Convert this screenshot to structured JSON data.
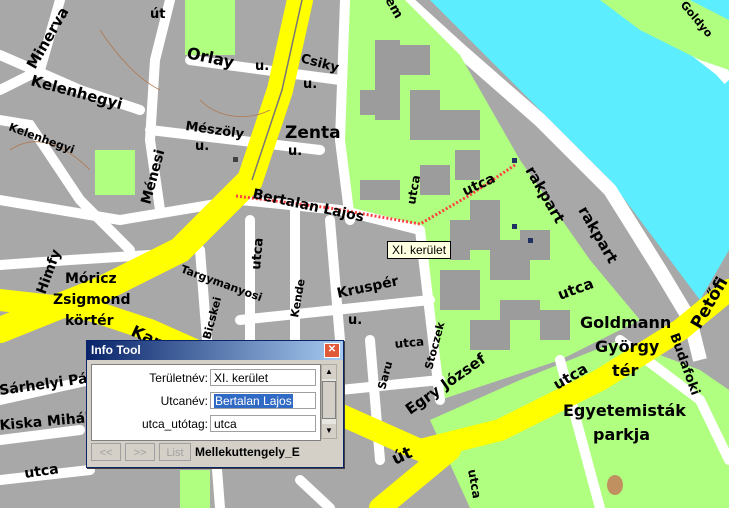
{
  "map": {
    "labels": {
      "minerva": "Minerva",
      "kelenhegyi": "Kelenhegyi",
      "kelenhegyi2": "Kelenhegyi",
      "ut_small": "út",
      "orlay": "Orlay",
      "orlay_u": "u.",
      "csiky": "Csiky",
      "csiky_u": "u.",
      "zenta": "Zenta",
      "zenta_u": "u.",
      "meszoly": "Mészöly",
      "meszoly_u": "u.",
      "menyoki": "Ménesi",
      "bertalan": "Bertalan Lajos",
      "utca1": "utca",
      "rakpart": "rakpart",
      "rakpart2": "rakpart",
      "himfy": "Himfy",
      "moricz1": "Móricz",
      "moricz2": "Zsigmond",
      "moricz3": "körtér",
      "karinthy": "Kar",
      "tarogy": "Targymanyosi",
      "bicske": "Bicskei",
      "kende": "Kende",
      "utca2": "utca",
      "krusper": "Kruspér",
      "krusper_u": "u.",
      "sarhelyi": "Sárhelyi Pál",
      "kaska": "Kiska Mihály",
      "utca3": "utca",
      "egry": "Egry József",
      "utca4": "utca",
      "ut_big": "út",
      "utca5": "utca",
      "goldmann1": "Goldmann",
      "goldmann2": "György",
      "goldmann3": "tér",
      "egyetemistak1": "Egyetemisták",
      "egyetemistak2": "parkja",
      "budafoki": "Budafoki",
      "petofi": "Petőfi",
      "gotyo": "Goldyo",
      "savoyai": "Saru",
      "stoczek": "Stoczek",
      "utca6": "utca",
      "utca7": "utca",
      "em": "em",
      "bottom": "utca"
    },
    "tooltip": "XI. kerület"
  },
  "dialog": {
    "title": "Info Tool",
    "close_glyph": "✕",
    "rows": [
      {
        "key": "Területnév:",
        "value": "XI. kerület"
      },
      {
        "key": "Utcanév:",
        "value": "Bertalan Lajos"
      },
      {
        "key": "utca_utótag:",
        "value": "utca"
      }
    ],
    "buttons": {
      "prev": "<<",
      "next": ">>",
      "list": "List"
    },
    "layer": "Mellekuttengely_E"
  },
  "colors": {
    "road_major": "#ffff00",
    "road_minor": "#ffffff",
    "block": "#a8a8a8",
    "park": "#b0ff80",
    "water": "#5ceeff",
    "building": "#9c9c9c"
  }
}
